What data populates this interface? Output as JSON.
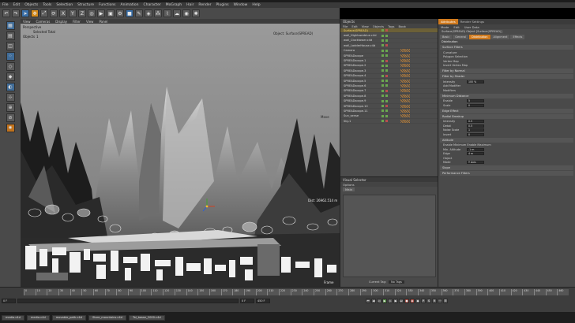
{
  "menubar": [
    "File",
    "Edit",
    "Objects",
    "Tools",
    "Selection",
    "Structure",
    "Functions",
    "Animation",
    "Character",
    "MoGraph",
    "Hair",
    "Render",
    "Plugins",
    "Window",
    "Help"
  ],
  "viewport": {
    "menu": [
      "View",
      "Cameras",
      "Display",
      "Filter",
      "View",
      "Panel"
    ],
    "label": "Perspective",
    "selected_total": "Selected Total",
    "objects_label": "Objects",
    "objects_count": "1",
    "object_info": "Object: Surface(SPREAD)",
    "move_label": "Move",
    "dist_label": "Dist: 26962.514 m",
    "frame_label": "Frame"
  },
  "objects": {
    "title": "Objects",
    "menu": [
      "File",
      "Edit",
      "View",
      "Objects",
      "Tags",
      "Book"
    ],
    "rows": [
      {
        "name": "Surface(SPREAD)",
        "selected": true
      },
      {
        "name": "wall_Hightownblue.c4d",
        "selected": false
      },
      {
        "name": "wall_Clocktower.c4d",
        "selected": false
      },
      {
        "name": "wall_LadderHouse.c4d",
        "selected": false
      },
      {
        "name": "Camera",
        "selected": false
      },
      {
        "name": "SPREADscape",
        "selected": false
      },
      {
        "name": "SPREADscape.1",
        "selected": false
      },
      {
        "name": "SPREADscape.2",
        "selected": false
      },
      {
        "name": "SPREADscape.3",
        "selected": false
      },
      {
        "name": "SPREADscape.4",
        "selected": false
      },
      {
        "name": "SPREADscape.5",
        "selected": false
      },
      {
        "name": "SPREADscape.6",
        "selected": false
      },
      {
        "name": "SPREADscape.7",
        "selected": false
      },
      {
        "name": "SPREADscape.8",
        "selected": false
      },
      {
        "name": "SPREADscape.9",
        "selected": false
      },
      {
        "name": "SPREADscape.10",
        "selected": false
      },
      {
        "name": "SPREADscape.11",
        "selected": false
      },
      {
        "name": "Sun_sense",
        "selected": false
      },
      {
        "name": "Sky.1",
        "selected": false
      }
    ]
  },
  "visual_selector": {
    "title": "Visual Selector",
    "options": "Options",
    "tab": "Main",
    "current_tag_label": "Current Tag:",
    "current_tag_value": "No Tags"
  },
  "attributes": {
    "tabs": [
      "Attributes",
      "Render Settings"
    ],
    "menu": [
      "Mode",
      "Edit",
      "User Data"
    ],
    "object_title": "Surface(SPREAD) Object [Surface(SPREAD)]",
    "subtabs": [
      "Basic",
      "General",
      "Distribution",
      "Alignment",
      "Effects"
    ],
    "section_distribution": "Distribution",
    "rows": [
      {
        "kind": "sec",
        "label": "Surface Filters"
      },
      {
        "kind": "row",
        "label": "Curvature"
      },
      {
        "kind": "row",
        "label": "Polygon Selection"
      },
      {
        "kind": "row",
        "label": "Vertex Map"
      },
      {
        "kind": "row",
        "label": "Invert Vertex Map"
      },
      {
        "kind": "sec",
        "label": "Filter by Normal"
      },
      {
        "kind": "sec",
        "label": "Filter by Shader"
      },
      {
        "kind": "field",
        "label": "Intensity",
        "value": "100 %"
      },
      {
        "kind": "row",
        "label": "Add Modifier"
      },
      {
        "kind": "row",
        "label": "Modifiers"
      },
      {
        "kind": "sec",
        "label": "Minimum Distance"
      },
      {
        "kind": "field",
        "label": "Enable",
        "value": "5"
      },
      {
        "kind": "field",
        "label": "Scale",
        "value": "0"
      },
      {
        "kind": "sec",
        "label": "Edge Effect"
      },
      {
        "kind": "sec",
        "label": "Radial Breakup"
      },
      {
        "kind": "field",
        "label": "Intensity",
        "value": "0.5"
      },
      {
        "kind": "field",
        "label": "Detail",
        "value": "0.5"
      },
      {
        "kind": "field",
        "label": "Noise Scale",
        "value": "1"
      },
      {
        "kind": "field",
        "label": "Invert",
        "value": "0"
      },
      {
        "kind": "sec",
        "label": "Altitude"
      },
      {
        "kind": "row",
        "label": "Enable Minimum    Enable Maximum"
      },
      {
        "kind": "field",
        "label": "Min. Altitude",
        "value": "-1 m"
      },
      {
        "kind": "field",
        "label": "Edge",
        "value": "4 m"
      },
      {
        "kind": "row",
        "label": "Object"
      },
      {
        "kind": "field",
        "label": "Mode",
        "value": "Y Axis"
      },
      {
        "kind": "sec",
        "label": "Slope"
      },
      {
        "kind": "sec",
        "label": "Performance Filters"
      }
    ]
  },
  "timeline": {
    "ticks": [
      "0",
      "10",
      "20",
      "30",
      "40",
      "50",
      "60",
      "70",
      "80",
      "90",
      "100",
      "110",
      "120",
      "130",
      "140",
      "150",
      "160",
      "170",
      "180",
      "190",
      "200",
      "210",
      "220",
      "230",
      "240",
      "250",
      "260",
      "270",
      "280",
      "290",
      "300",
      "310",
      "320",
      "330",
      "340",
      "350",
      "360",
      "370",
      "380",
      "390",
      "400",
      "410",
      "420",
      "430",
      "440",
      "450",
      "460"
    ],
    "start_field": "0 F",
    "end_field": "0 F",
    "current_field": "0 F",
    "max_field": "450 F"
  },
  "taskbar": [
    "media.c4d",
    "media.c4d",
    "movable_path.c4d",
    "Store_mountains.c4d",
    "Tai_basse_2000.c4d"
  ],
  "colors": {
    "accent": "#d07a1e",
    "selection": "#6c6037"
  }
}
